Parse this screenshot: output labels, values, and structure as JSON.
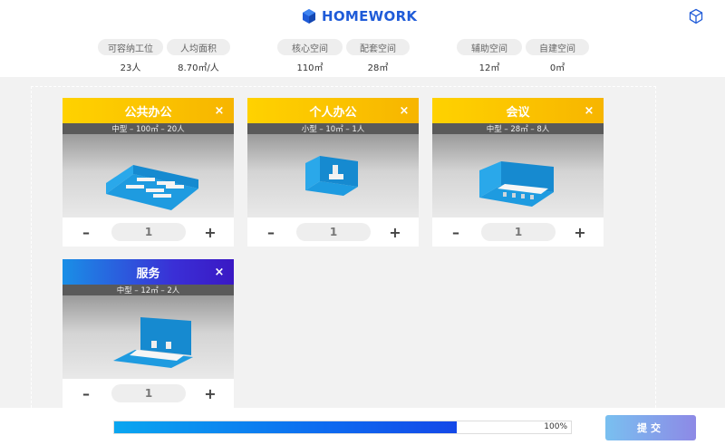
{
  "header": {
    "brand": "HOMEWORK",
    "logo_icon": "hexagon-cube-icon",
    "cube_icon": "3d-cube-icon",
    "brand_color": "#1f5bd8"
  },
  "stats": [
    {
      "label": "可容纳工位",
      "value": "23人"
    },
    {
      "label": "人均面积",
      "value": "8.70㎡/人"
    },
    {
      "label": "核心空间",
      "value": "110㎡"
    },
    {
      "label": "配套空间",
      "value": "28㎡"
    },
    {
      "label": "辅助空间",
      "value": "12㎡"
    },
    {
      "label": "自建空间",
      "value": "0㎡"
    }
  ],
  "cards": [
    {
      "title": "公共办公",
      "subtitle": "中型 – 100㎡ – 20人",
      "qty": "1",
      "close": "×",
      "minus": "–",
      "plus": "+",
      "theme": "yellow"
    },
    {
      "title": "个人办公",
      "subtitle": "小型 – 10㎡ – 1人",
      "qty": "1",
      "close": "×",
      "minus": "–",
      "plus": "+",
      "theme": "yellow"
    },
    {
      "title": "会议",
      "subtitle": "中型 – 28㎡ – 8人",
      "qty": "1",
      "close": "×",
      "minus": "–",
      "plus": "+",
      "theme": "yellow"
    },
    {
      "title": "服务",
      "subtitle": "中型 – 12㎡ – 2人",
      "qty": "1",
      "close": "×",
      "minus": "–",
      "plus": "+",
      "theme": "blue"
    }
  ],
  "progress": {
    "fraction": 0.75,
    "percent_label": "100%"
  },
  "submit_label": "提交",
  "colors": {
    "yellow_start": "#ffd200",
    "yellow_end": "#f7b500",
    "blue_start": "#1a8fe6",
    "blue_end": "#3a18c4",
    "room_blue": "#1e9be0"
  }
}
